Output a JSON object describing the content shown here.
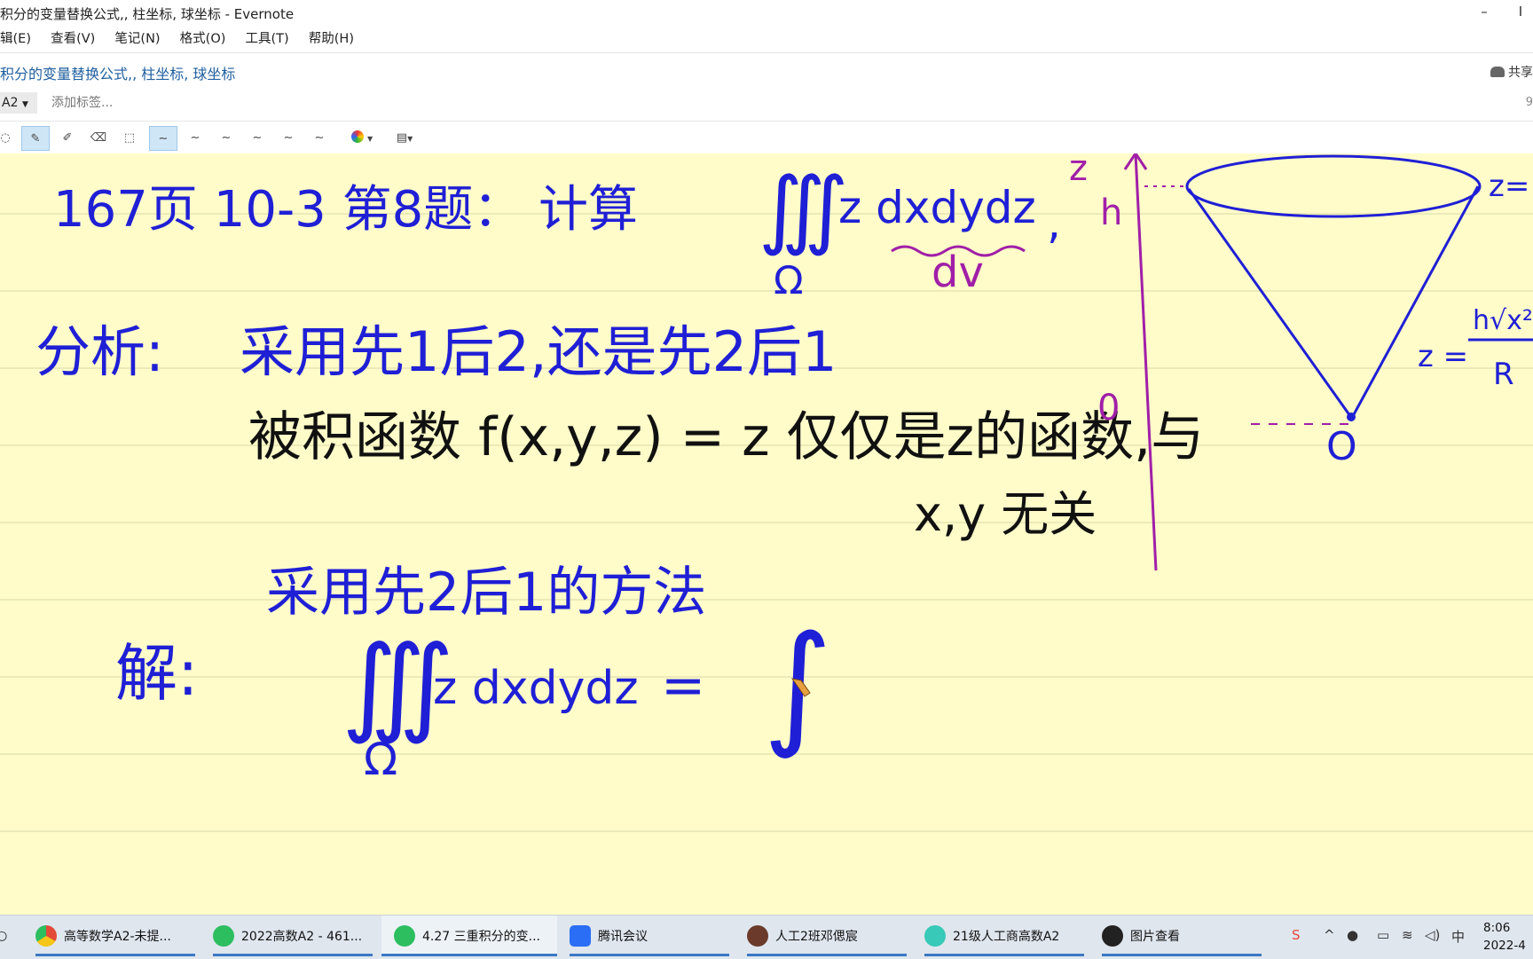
{
  "window": {
    "title": "积分的变量替换公式,, 柱坐标, 球坐标 - Evernote",
    "minimize": "–",
    "close": "I"
  },
  "menu": [
    "辑(E)",
    "查看(V)",
    "笔记(N)",
    "格式(O)",
    "工具(T)",
    "帮助(H)"
  ],
  "note": {
    "title": "积分的变量替换公式,, 柱坐标, 球坐标",
    "share_label": "共享",
    "notebook": "A2",
    "tag_placeholder": "添加标签...",
    "right_number": "9"
  },
  "toolbar": {
    "tools": [
      "lasso-icon",
      "pen-icon",
      "highlighter-icon",
      "eraser-icon",
      "selection-icon",
      "stroke-1-icon",
      "stroke-2-icon",
      "stroke-3-icon",
      "stroke-4-icon",
      "stroke-5-icon",
      "stroke-6-icon",
      "color-picker-icon",
      "fill-icon"
    ],
    "active_pen": "pen-icon",
    "active_stroke": "stroke-1-icon",
    "ink_colors": {
      "blue": "#1f1fd6",
      "purple": "#a01fa8",
      "black": "#111111"
    }
  },
  "handwriting": {
    "line1": "167页   10-3 第8题：计算 ∭Ω z dxdydz ，",
    "line1_dv": "dv",
    "line2": "分析：采用先1后2，还是先2后1",
    "line3": "被积函数 f(x,y,z) = z 仅仅是z的函数，与",
    "line4": "x,y 无关",
    "line5": "采用先2后1的方法",
    "line6": "解：∭Ω z dxdydz = ∫",
    "diagram_labels": {
      "axis": "z",
      "height": "h",
      "origin": "O",
      "plane": "z=",
      "cone": "z = h√(x²+y²) / R"
    }
  },
  "taskbar": {
    "items": [
      {
        "label": "高等数学A2-未提...",
        "icon": "chrome-icon",
        "color": "#e34a3a"
      },
      {
        "label": "2022高数A2 - 461...",
        "icon": "evernote-icon",
        "color": "#2dbe60"
      },
      {
        "label": "4.27 三重积分的变...",
        "icon": "evernote-icon",
        "color": "#2dbe60"
      },
      {
        "label": "腾讯会议",
        "icon": "tencent-meeting-icon",
        "color": "#2a6ef5"
      },
      {
        "label": "人工2班邓偲宸",
        "icon": "avatar-icon",
        "color": "#6b3a2a"
      },
      {
        "label": "21级人工商高数A2",
        "icon": "bulb-icon",
        "color": "#38c9b8"
      },
      {
        "label": "图片查看",
        "icon": "qq-icon",
        "color": "#222222"
      }
    ],
    "active_index": 2,
    "tray_ime": "中",
    "time": "8:06",
    "date": "2022-4"
  }
}
